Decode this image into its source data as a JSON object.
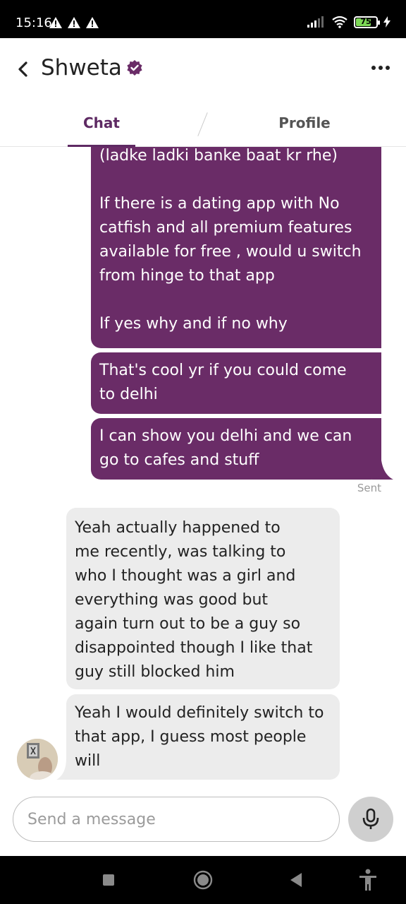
{
  "status_bar": {
    "time": "15:16",
    "battery": "75",
    "battery_level": 0.75,
    "icons": [
      "warning-icon",
      "warning-icon",
      "warning-icon",
      "signal-icon",
      "wifi-icon",
      "battery-icon",
      "charging-icon"
    ]
  },
  "header": {
    "title": "Shweta",
    "verified_icon": "verified-badge-icon",
    "back_icon": "chevron-left-icon",
    "more_icon": "more-icon"
  },
  "tabs": [
    {
      "label": "Chat",
      "active": true
    },
    {
      "label": "Profile",
      "active": false
    }
  ],
  "messages": [
    {
      "direction": "outgoing",
      "lines": [
        "(ladke ladki banke baat kr rhe)",
        "",
        "If there is a dating app with No",
        "catfish and all premium features",
        "available for free  , would u switch",
        "from hinge to that app",
        "",
        "If yes why and if no why"
      ]
    },
    {
      "direction": "outgoing",
      "lines": [
        "That's cool yr if you could come",
        "to delhi"
      ]
    },
    {
      "direction": "outgoing",
      "lines": [
        "I can show you delhi and we can",
        "go to cafes and stuff"
      ],
      "status": "Sent"
    },
    {
      "direction": "incoming",
      "lines": [
        "Yeah actually happened to",
        "me recently, was talking to",
        "who I thought was a girl and",
        "everything was good but",
        "again turn out to be a guy so",
        "disappointed though I like that",
        "guy still blocked him"
      ]
    },
    {
      "direction": "incoming",
      "lines": [
        "Yeah I would definitely switch to",
        "that app, I guess most people",
        "will"
      ]
    }
  ],
  "composer": {
    "placeholder": "Send a message",
    "mic_icon": "microphone-icon"
  },
  "colors": {
    "accent": "#5e2a63",
    "outgoing_bubble": "#6a2c67",
    "incoming_bubble": "#ececec"
  }
}
